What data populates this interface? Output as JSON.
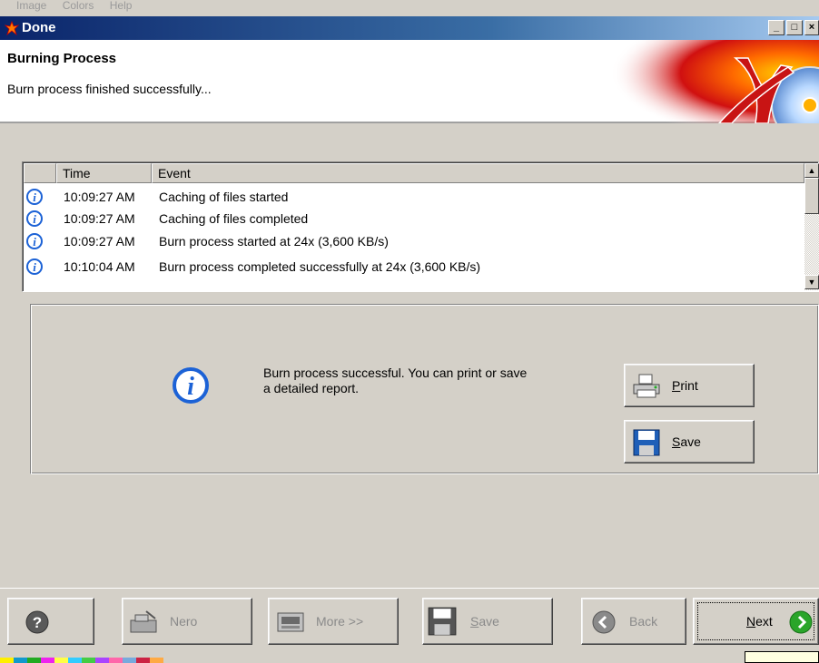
{
  "background_menu": [
    "Image",
    "Colors",
    "Help"
  ],
  "window": {
    "title": "Done",
    "controls": [
      "minimize",
      "maximize",
      "close"
    ]
  },
  "header": {
    "title": "Burning Process",
    "subtitle": "Burn process finished successfully..."
  },
  "event_list": {
    "columns": [
      "",
      "Time",
      "Event"
    ],
    "rows": [
      {
        "icon": "info-icon",
        "time": "10:09:27 AM",
        "event": "Caching of files started"
      },
      {
        "icon": "info-icon",
        "time": "10:09:27 AM",
        "event": "Caching of files completed"
      },
      {
        "icon": "info-icon",
        "time": "10:09:27 AM",
        "event": "Burn process started at 24x (3,600 KB/s)"
      },
      {
        "icon": "info-icon",
        "time": "10:10:04 AM",
        "event": "Burn process completed successfully at 24x (3,600 KB/s)"
      }
    ]
  },
  "report": {
    "message": "Burn process successful. You can print or save a detailed report.",
    "print_button": {
      "underline": "P",
      "rest": "rint",
      "icon": "printer-icon"
    },
    "save_button": {
      "underline": "S",
      "rest": "ave",
      "icon": "floppy-disk-icon"
    }
  },
  "footer": {
    "help_icon": "question-icon",
    "nero": {
      "label": "Nero",
      "icon": "nero-icon",
      "enabled": false
    },
    "more": {
      "label": "More >>",
      "icon": "drive-icon",
      "enabled": false
    },
    "save": {
      "underline": "S",
      "rest": "ave",
      "icon": "floppy-disk-icon",
      "enabled": false
    },
    "back": {
      "label": "Back",
      "icon": "back-arrow-icon",
      "enabled": false
    },
    "next": {
      "underline": "N",
      "rest": "ext",
      "icon": "next-arrow-icon",
      "enabled": true
    }
  },
  "colors": {
    "titlebar_start": "#0a246a",
    "info_icon": "#1c62d6",
    "next_icon": "#2aa52a",
    "face": "#d4d0c8"
  }
}
